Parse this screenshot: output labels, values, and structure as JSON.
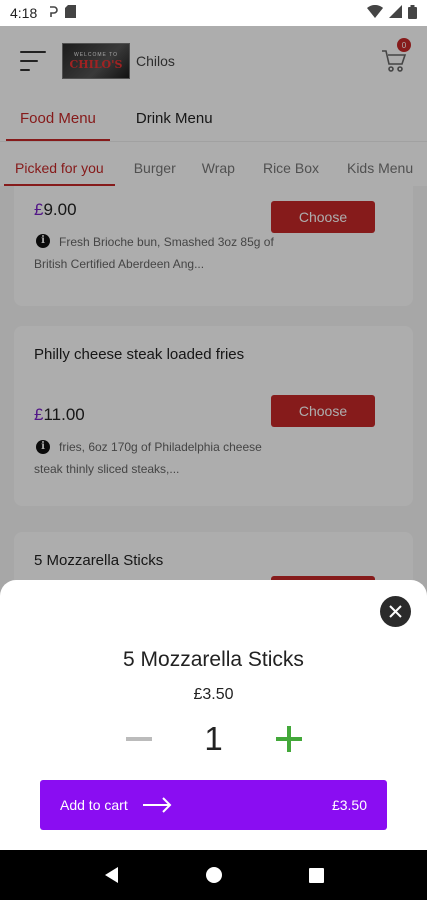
{
  "status_bar": {
    "time": "4:18"
  },
  "header": {
    "logo_line1": "WELCOME TO",
    "logo_line2": "CHILO'S",
    "brand": "Chilos",
    "cart_count": "0"
  },
  "menu_tabs": [
    {
      "label": "Food Menu",
      "active": true
    },
    {
      "label": "Drink Menu",
      "active": false
    }
  ],
  "category_tabs": [
    {
      "label": "Picked for you",
      "active": true
    },
    {
      "label": "Burger"
    },
    {
      "label": "Wrap"
    },
    {
      "label": "Rice Box"
    },
    {
      "label": "Kids Menu"
    }
  ],
  "items": [
    {
      "name": "",
      "currency": "£",
      "price": "9.00",
      "description": "Fresh Brioche bun, Smashed 3oz 85g of British Certified Aberdeen Ang...",
      "button": "Choose"
    },
    {
      "name": "Philly cheese steak loaded fries",
      "currency": "£",
      "price": "11.00",
      "description": "fries, 6oz 170g of Philadelphia cheese steak thinly sliced steaks,...",
      "button": "Choose"
    },
    {
      "name": "5 Mozzarella Sticks"
    }
  ],
  "sheet": {
    "title": "5 Mozzarella Sticks",
    "price": "£3.50",
    "quantity": "1",
    "add_label": "Add to cart",
    "add_total": "£3.50"
  },
  "colors": {
    "accent_red": "#c62828",
    "purple": "#8a0df2",
    "green": "#43a83a"
  }
}
